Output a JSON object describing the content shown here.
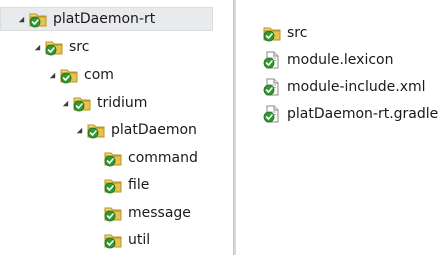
{
  "tree": {
    "nodes": [
      {
        "label": "platDaemon-rt"
      },
      {
        "label": "src"
      },
      {
        "label": "com"
      },
      {
        "label": "tridium"
      },
      {
        "label": "platDaemon"
      },
      {
        "label": "command"
      },
      {
        "label": "file"
      },
      {
        "label": "message"
      },
      {
        "label": "util"
      }
    ]
  },
  "contents": {
    "items": [
      {
        "label": "src",
        "icon": "folder-icon"
      },
      {
        "label": "module.lexicon",
        "icon": "file-icon"
      },
      {
        "label": "module-include.xml",
        "icon": "file-icon"
      },
      {
        "label": "platDaemon-rt.gradle",
        "icon": "file-icon"
      }
    ]
  },
  "colors": {
    "folder": "#e8c24a",
    "check": "#2f9b2f",
    "selection": "#e9eaec"
  }
}
